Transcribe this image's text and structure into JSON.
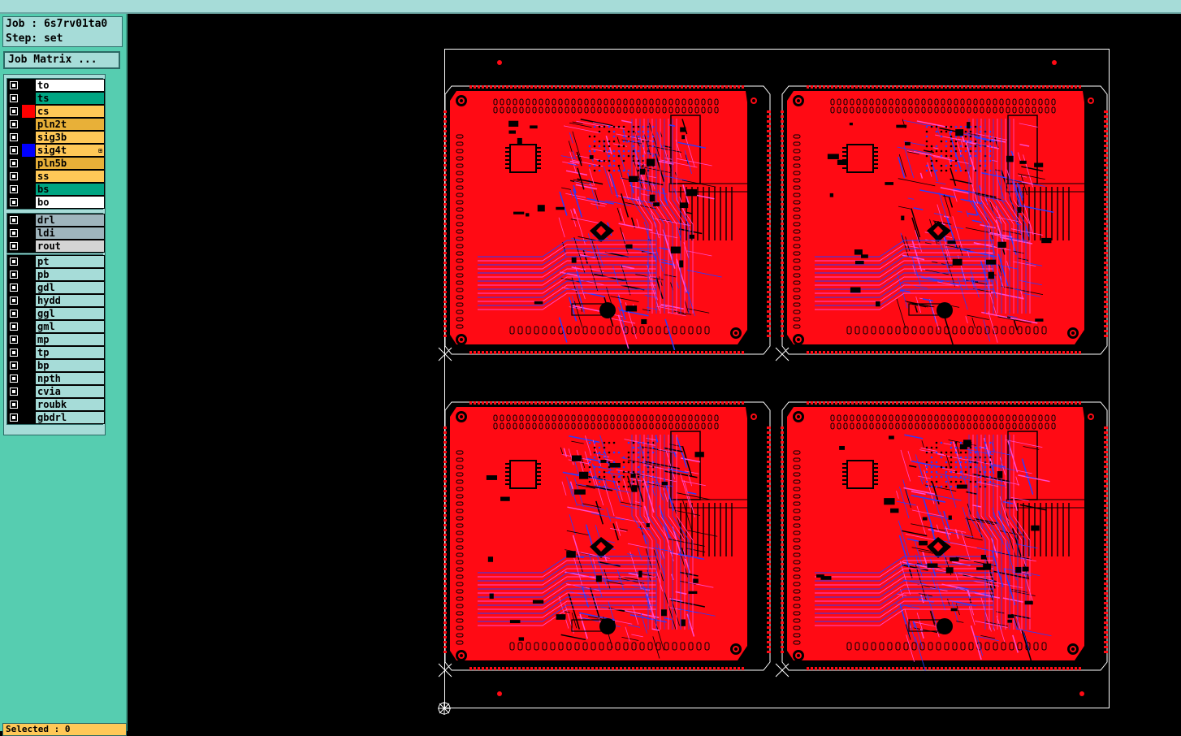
{
  "job_info": {
    "job_line": "Job : 6s7rv01ta0",
    "step_line": "Step: set"
  },
  "job_matrix_button": "Job Matrix ...",
  "colors": {
    "white": "#ffffff",
    "green": "#00a582",
    "orange": "#ffc857",
    "dark_orange": "#e8b038",
    "gray": "#9fb5bd",
    "light_gray": "#d4d4d4",
    "cyan": "#a6dcd8",
    "red_swatch": "#ff0000",
    "blue_swatch": "#0000ff",
    "board_red": "#ff0a14",
    "trace_blue": "#2a3cff",
    "trace_magenta": "#ff4bd2"
  },
  "board_layers": [
    {
      "name": "to",
      "color": "white"
    },
    {
      "name": "ts",
      "color": "green"
    },
    {
      "name": "cs",
      "color": "orange",
      "swatch": "red_swatch"
    },
    {
      "name": "pln2t",
      "color": "dark_orange"
    },
    {
      "name": "sig3b",
      "color": "orange"
    },
    {
      "name": "sig4t",
      "color": "orange",
      "swatch": "blue_swatch",
      "mark": "⊞"
    },
    {
      "name": "pln5b",
      "color": "dark_orange"
    },
    {
      "name": "ss",
      "color": "orange"
    },
    {
      "name": "bs",
      "color": "green"
    },
    {
      "name": "bo",
      "color": "white"
    }
  ],
  "drill_layers": [
    {
      "name": "drl",
      "color": "gray"
    },
    {
      "name": "ldi",
      "color": "gray"
    },
    {
      "name": "rout",
      "color": "light_gray"
    }
  ],
  "misc_layers": [
    {
      "name": "pt"
    },
    {
      "name": "pb"
    },
    {
      "name": "gdl"
    },
    {
      "name": "hydd"
    },
    {
      "name": "ggl"
    },
    {
      "name": "gml"
    },
    {
      "name": "mp"
    },
    {
      "name": "tp"
    },
    {
      "name": "bp"
    },
    {
      "name": "npth"
    },
    {
      "name": "cvia"
    },
    {
      "name": "roubk"
    },
    {
      "name": "gbdrl"
    }
  ],
  "status": {
    "selected_text": "Selected : 0"
  },
  "panel": {
    "boards": [
      {
        "id": "board-1"
      },
      {
        "id": "board-2"
      },
      {
        "id": "board-3"
      },
      {
        "id": "board-4"
      }
    ]
  }
}
